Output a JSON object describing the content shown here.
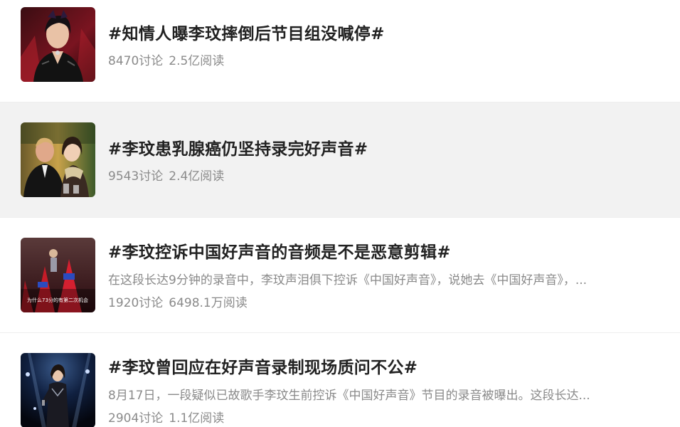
{
  "topics": [
    {
      "title": "#知情人曝李玟摔倒后节目组没喊停#",
      "summary": "",
      "discuss": "8470讨论",
      "reads": "2.5亿阅读",
      "thumb_icon": "singer-portrait-image"
    },
    {
      "title": "#李玟患乳腺癌仍坚持录完好声音#",
      "summary": "",
      "discuss": "9543讨论",
      "reads": "2.4亿阅读",
      "thumb_icon": "couple-photo-image"
    },
    {
      "title": "#李玟控诉中国好声音的音频是不是恶意剪辑#",
      "summary": "在这段长达9分钟的录音中，李玟声泪俱下控诉《中国好声音》，说她去《中国好声音》，...",
      "discuss": "1920讨论",
      "reads": "6498.1万阅读",
      "thumb_icon": "stage-video-still-image",
      "thumb_caption": "为什么73分的有第二次机会"
    },
    {
      "title": "#李玟曾回应在好声音录制现场质问不公#",
      "summary": "8月17日，一段疑似已故歌手李玟生前控诉《中国好声音》节目的录音被曝出。这段长达...",
      "discuss": "2904讨论",
      "reads": "1.1亿阅读",
      "thumb_icon": "stage-performance-image"
    }
  ]
}
